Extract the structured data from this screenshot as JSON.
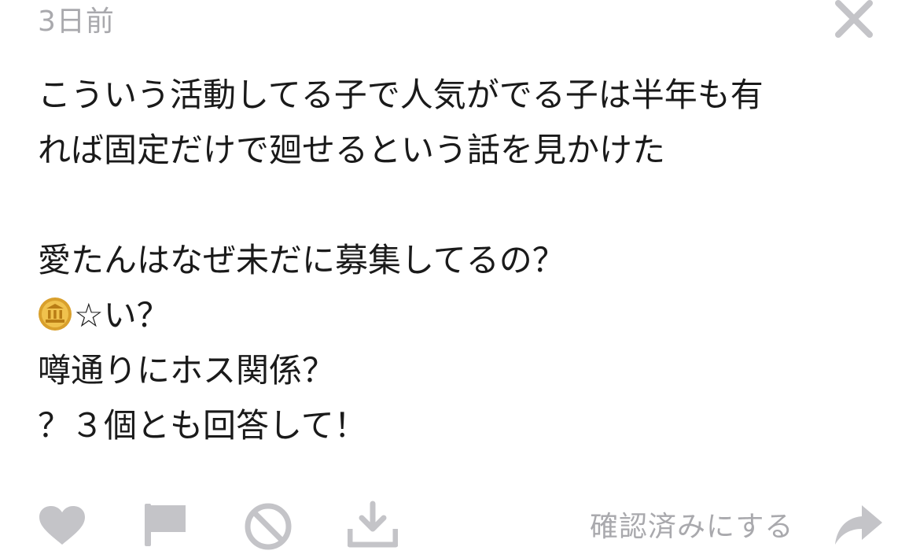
{
  "post": {
    "timestamp": "3日前",
    "lines": [
      "こういう活動してる子で人気がでる子は半年も有",
      "れば固定だけで廻せるという話を見かけた",
      "",
      "愛たんはなぜ未だに募集してるの？",
      "☆い？",
      "噂通りにホス関係？",
      "？３個とも回答して！"
    ]
  },
  "icons": {
    "close": "close-icon",
    "coin": "bank-coin-icon",
    "like": "heart-icon",
    "report": "flag-icon",
    "block": "block-icon",
    "save": "download-icon",
    "forward": "forward-arrow-icon"
  },
  "actions": {
    "confirm_label": "確認済みにする"
  },
  "colors": {
    "icon_gray": "#c4c4c8",
    "text": "#1a1a1a",
    "muted": "#a9a9ad",
    "coin_gold": "#e8b43a"
  }
}
